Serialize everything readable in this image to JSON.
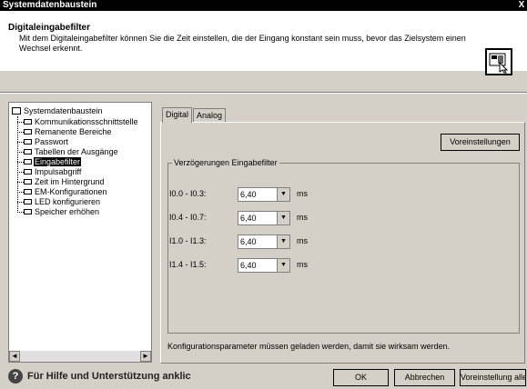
{
  "window": {
    "title": "Systemdatenbaustein",
    "close_glyph": "X"
  },
  "header": {
    "title": "Digitaleingabefilter",
    "description": "Mit dem Digitaleingabefilter können Sie die Zeit einstellen, die der Eingang konstant sein muss, bevor das Zielsystem einen Wechsel erkennt.",
    "icon": "filter-settings-icon"
  },
  "tree": {
    "root": "Systemdatenbaustein",
    "items": [
      {
        "label": "Kommunikationsschnittstelle",
        "selected": false
      },
      {
        "label": "Remanente Bereiche",
        "selected": false
      },
      {
        "label": "Passwort",
        "selected": false
      },
      {
        "label": "Tabellen der Ausgänge",
        "selected": false
      },
      {
        "label": "Eingabefilter",
        "selected": true
      },
      {
        "label": "Impulsabgriff",
        "selected": false
      },
      {
        "label": "Zeit im Hintergrund",
        "selected": false
      },
      {
        "label": "EM-Konfigurationen",
        "selected": false
      },
      {
        "label": "LED konfigurieren",
        "selected": false
      },
      {
        "label": "Speicher erhöhen",
        "selected": false
      }
    ],
    "scroll_left": "◄",
    "scroll_right": "►"
  },
  "tabs": [
    {
      "label": "Digital",
      "active": true
    },
    {
      "label": "Analog",
      "active": false
    }
  ],
  "panel": {
    "defaults_button": "Voreinstellungen",
    "group_title": "Verzögerungen Eingabefilter",
    "rows": [
      {
        "label": "I0.0 - I0.3:",
        "value": "6,40",
        "unit": "ms"
      },
      {
        "label": "I0.4 - I0.7:",
        "value": "6,40",
        "unit": "ms"
      },
      {
        "label": "I1.0 - I1.3:",
        "value": "6,40",
        "unit": "ms"
      },
      {
        "label": "I1.4 - I1.5:",
        "value": "6,40",
        "unit": "ms"
      }
    ],
    "dropdown_glyph": "▼",
    "note": "Konfigurationsparameter müssen geladen werden, damit sie wirksam werden."
  },
  "footer": {
    "help_glyph": "?",
    "help_text": "Für Hilfe und Unterstützung anklic",
    "ok": "OK",
    "cancel": "Abbrechen",
    "defaults_all": "Voreinstellung alle"
  }
}
